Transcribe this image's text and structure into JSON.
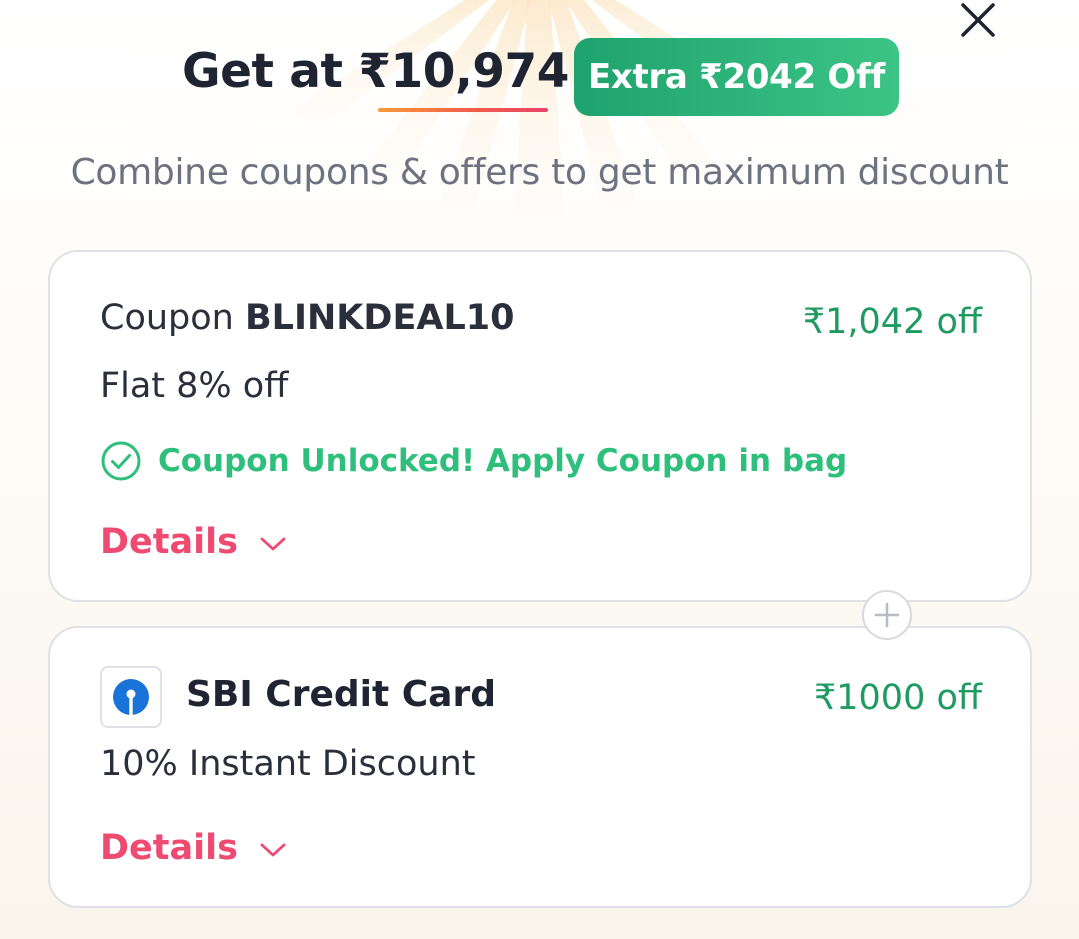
{
  "header": {
    "price_text": "Get at ₹10,974",
    "extra_badge": "Extra ₹2042 Off",
    "subtitle": "Combine coupons & offers to get maximum discount"
  },
  "coupon_card": {
    "prefix": "Coupon ",
    "code": "BLINKDEAL10",
    "amount": "₹1,042 off",
    "description": "Flat 8% off",
    "status": "Coupon Unlocked! Apply Coupon in bag",
    "details_label": "Details"
  },
  "bank_card": {
    "name": "SBI Credit Card",
    "amount": "₹1000 off",
    "description": "10% Instant Discount",
    "details_label": "Details"
  },
  "colors": {
    "accent_green": "#1f9a63",
    "status_green": "#2fbf7c",
    "details_pink": "#ee4a72",
    "badge_green": "#1fa36e",
    "sbi_blue": "#1a73d9"
  },
  "icons": [
    "close-icon",
    "check-circle-icon",
    "chevron-down-icon",
    "plus-circle-icon",
    "sbi-logo-icon"
  ]
}
